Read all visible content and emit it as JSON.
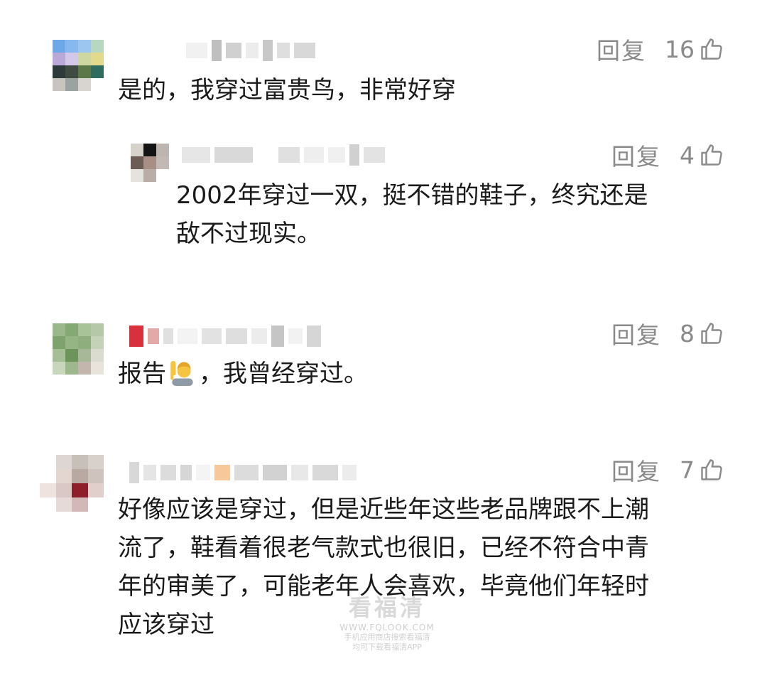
{
  "comments": [
    {
      "reply_label": "回复",
      "likes": "16",
      "text": "是的，我穿过富贵鸟，非常好穿"
    },
    {
      "reply_label": "回复",
      "likes": "4",
      "text_line1": "2002年穿过一双，挺不错的鞋子，终究还是",
      "text_line2": "敌不过现实。"
    },
    {
      "reply_label": "回复",
      "likes": "8",
      "text_before": "报告",
      "text_after": "，我曾经穿过。",
      "emoji": "person-raising-hand-emoji"
    },
    {
      "reply_label": "回复",
      "likes": "7",
      "text_line1": "好像应该是穿过，但是近些年这些老品牌跟不上潮",
      "text_line2": "流了，鞋看着很老气款式也很旧，已经不符合中青",
      "text_line3": "年的审美了，可能老年人会喜欢，毕竟他们年轻时",
      "text_line4": "应该穿过"
    }
  ],
  "watermark": {
    "title": "看福清",
    "url": "WWW.FQLOOK.COM",
    "line1": "手机应用商店搜索看福清",
    "line2": "均可下载看福清APP"
  },
  "colors": {
    "text": "#1a1a1a",
    "muted": "#8a8a8a"
  },
  "icons": [
    "thumbs-up-icon",
    "blurred-avatar",
    "blurred-username"
  ]
}
